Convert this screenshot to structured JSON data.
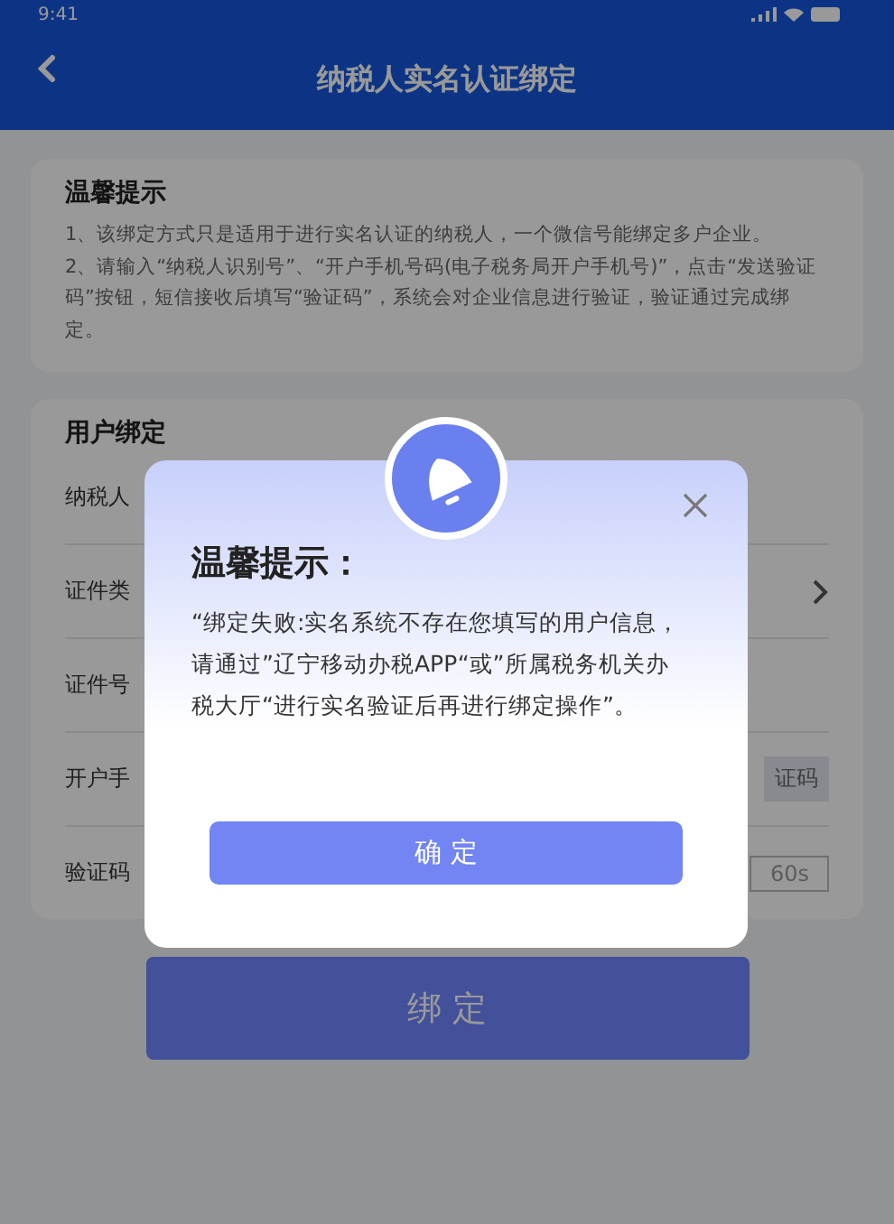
{
  "status_bar": {
    "time": "9:41"
  },
  "header": {
    "title": "纳税人实名认证绑定"
  },
  "notice": {
    "title": "温馨提示",
    "paragraphs": [
      "1、该绑定方式只是适用于进行实名认证的纳税人，一个微信号能绑定多户企业。",
      "2、请输入“纳税人识别号”、“开户手机号码(电子税务局开户手机号)”，点击“发送验证码”按钮，短信接收后填写“验证码”，系统会对企业信息进行验证，验证通过完成绑定。"
    ]
  },
  "binding": {
    "title": "用户绑定",
    "fields": [
      {
        "kind": "text",
        "label": "纳税人"
      },
      {
        "kind": "select",
        "label": "证件类"
      },
      {
        "kind": "text",
        "label": "证件号"
      },
      {
        "kind": "code_button",
        "label": "开户手",
        "action": "证码"
      },
      {
        "kind": "countdown",
        "label": "验证码",
        "action": "60s"
      }
    ]
  },
  "submit_button": "绑 定",
  "dialog": {
    "title": "温馨提示：",
    "message": "“绑定失败:实名系统不存在您填写的用户信息，请通过”辽宁移动办税APP“或”所属税务机关办税大厅“进行实名验证后再进行绑定操作”。",
    "confirm": "确 定"
  }
}
